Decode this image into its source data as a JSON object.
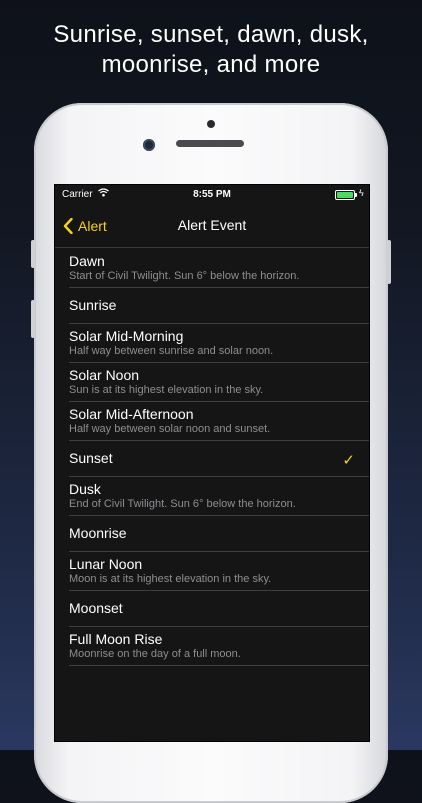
{
  "headline": {
    "line1": "Sunrise, sunset, dawn, dusk,",
    "line2": "moonrise, and more"
  },
  "status_bar": {
    "carrier": "Carrier",
    "time": "8:55 PM",
    "battery_level": 1.0,
    "battery_color": "#4cd964"
  },
  "nav": {
    "back_label": "Alert",
    "title": "Alert Event",
    "accent_color": "#f5d21c"
  },
  "events": [
    {
      "title": "Dawn",
      "subtitle": "Start of Civil Twilight. Sun 6° below the horizon.",
      "selected": false
    },
    {
      "title": "Sunrise",
      "subtitle": "",
      "selected": false
    },
    {
      "title": "Solar Mid-Morning",
      "subtitle": "Half way between sunrise and solar noon.",
      "selected": false
    },
    {
      "title": "Solar Noon",
      "subtitle": "Sun is at its highest elevation in the sky.",
      "selected": false
    },
    {
      "title": "Solar Mid-Afternoon",
      "subtitle": "Half way between solar noon and sunset.",
      "selected": false
    },
    {
      "title": "Sunset",
      "subtitle": "",
      "selected": true
    },
    {
      "title": "Dusk",
      "subtitle": "End of Civil Twilight. Sun 6° below the horizon.",
      "selected": false
    },
    {
      "title": "Moonrise",
      "subtitle": "",
      "selected": false
    },
    {
      "title": "Lunar Noon",
      "subtitle": "Moon is at its highest elevation in the sky.",
      "selected": false
    },
    {
      "title": "Moonset",
      "subtitle": "",
      "selected": false
    },
    {
      "title": "Full Moon Rise",
      "subtitle": "Moonrise on the day of a full moon.",
      "selected": false
    }
  ],
  "check_glyph": "✓"
}
